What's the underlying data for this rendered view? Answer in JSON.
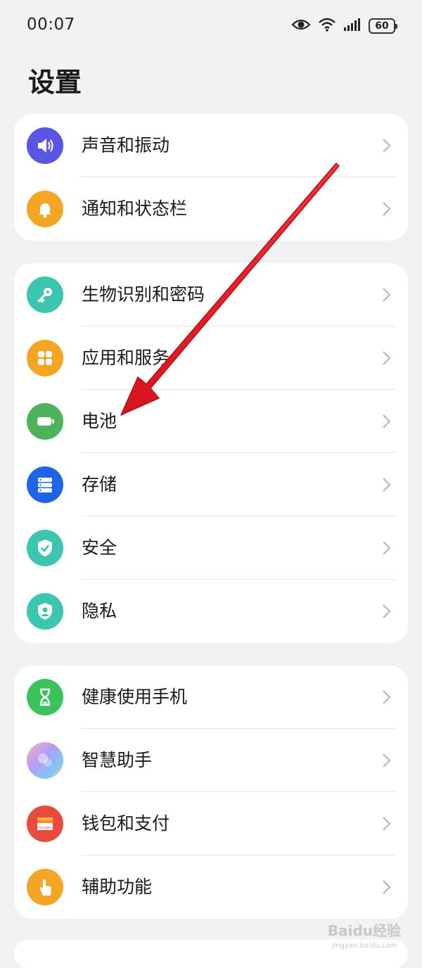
{
  "status_bar": {
    "time": "00:07",
    "battery": "60",
    "icons": [
      "eye-icon",
      "wifi-icon",
      "signal-icon",
      "battery-icon"
    ]
  },
  "page": {
    "title": "设置"
  },
  "groups": [
    {
      "items": [
        {
          "label": "声音和振动",
          "icon": "sound-icon",
          "color": "#5b55e6"
        },
        {
          "label": "通知和状态栏",
          "icon": "bell-icon",
          "color": "#f5a524"
        }
      ]
    },
    {
      "items": [
        {
          "label": "生物识别和密码",
          "icon": "key-icon",
          "color": "#3cc6b0"
        },
        {
          "label": "应用和服务",
          "icon": "apps-icon",
          "color": "#f5a524"
        },
        {
          "label": "电池",
          "icon": "battery-icon",
          "color": "#4cb35a"
        },
        {
          "label": "存储",
          "icon": "storage-icon",
          "color": "#1f64e6"
        },
        {
          "label": "安全",
          "icon": "shield-check-icon",
          "color": "#3cc6b0"
        },
        {
          "label": "隐私",
          "icon": "privacy-icon",
          "color": "#3cc6b0"
        }
      ]
    },
    {
      "items": [
        {
          "label": "健康使用手机",
          "icon": "hourglass-icon",
          "color": "#3cc25a"
        },
        {
          "label": "智慧助手",
          "icon": "assistant-icon",
          "color": "#9b8cf0"
        },
        {
          "label": "钱包和支付",
          "icon": "wallet-icon",
          "color": "#e84a3c"
        },
        {
          "label": "辅助功能",
          "icon": "accessibility-icon",
          "color": "#f5a524"
        }
      ]
    }
  ],
  "wallet_badge_text": "HUAWEI",
  "watermark": {
    "brand": "Baidu经验",
    "url": "jingyan.baidu.com"
  }
}
